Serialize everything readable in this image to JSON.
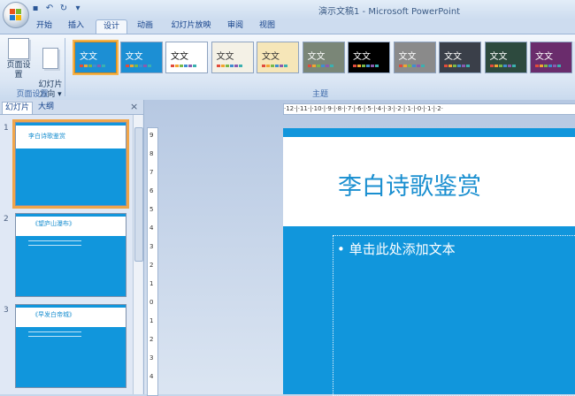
{
  "app": {
    "title": "演示文稿1 - Microsoft PowerPoint",
    "qat": [
      "save-icon",
      "undo-icon",
      "redo-icon",
      "customize-icon"
    ]
  },
  "tabs": [
    "开始",
    "插入",
    "设计",
    "动画",
    "幻灯片放映",
    "审阅",
    "视图"
  ],
  "active_tab": "设计",
  "ribbon": {
    "page_setup": {
      "label": "页面设置",
      "orientation": "幻灯片\n方向 ▾",
      "group": "页面设置"
    },
    "themes_group": "主题",
    "themes": [
      {
        "text": "文文",
        "bg": "#1c8fd4",
        "fg": "#fff",
        "selected": true
      },
      {
        "text": "文文",
        "bg": "#1c8fd4",
        "fg": "#fff"
      },
      {
        "text": "文文",
        "bg": "#ffffff",
        "fg": "#111"
      },
      {
        "text": "文文",
        "bg": "#f4f1e6",
        "fg": "#333"
      },
      {
        "text": "文文",
        "bg": "#f6e6b8",
        "fg": "#333"
      },
      {
        "text": "文文",
        "bg": "#7a8677",
        "fg": "#fff"
      },
      {
        "text": "文文",
        "bg": "#000000",
        "fg": "#fff"
      },
      {
        "text": "文文",
        "bg": "#8a8a8a",
        "fg": "#fff"
      },
      {
        "text": "文文",
        "bg": "#3a3f49",
        "fg": "#fff"
      },
      {
        "text": "文文",
        "bg": "#2d4a3e",
        "fg": "#fff"
      },
      {
        "text": "文文",
        "bg": "#6a2c6c",
        "fg": "#fff"
      }
    ]
  },
  "pane": {
    "tab_slides": "幻灯片",
    "tab_outline": "大纲",
    "close": "×",
    "slides": [
      {
        "num": "1",
        "title": "李白诗歌鉴赏"
      },
      {
        "num": "2",
        "title": "《望庐山瀑布》"
      },
      {
        "num": "3",
        "title": "《早发白帝城》"
      }
    ]
  },
  "ruler": {
    "h": "·12·|·11·|·10·|·9·|·8·|·7·|·6·|·5·|·4·|·3·|·2·|·1·|·0·|·1·|·2·",
    "v": [
      "9",
      "8",
      "7",
      "6",
      "5",
      "4",
      "3",
      "2",
      "1",
      "0",
      "1",
      "2",
      "3",
      "4"
    ]
  },
  "slide": {
    "title": "李白诗歌鉴赏",
    "placeholder": "• 单击此处添加文本"
  }
}
